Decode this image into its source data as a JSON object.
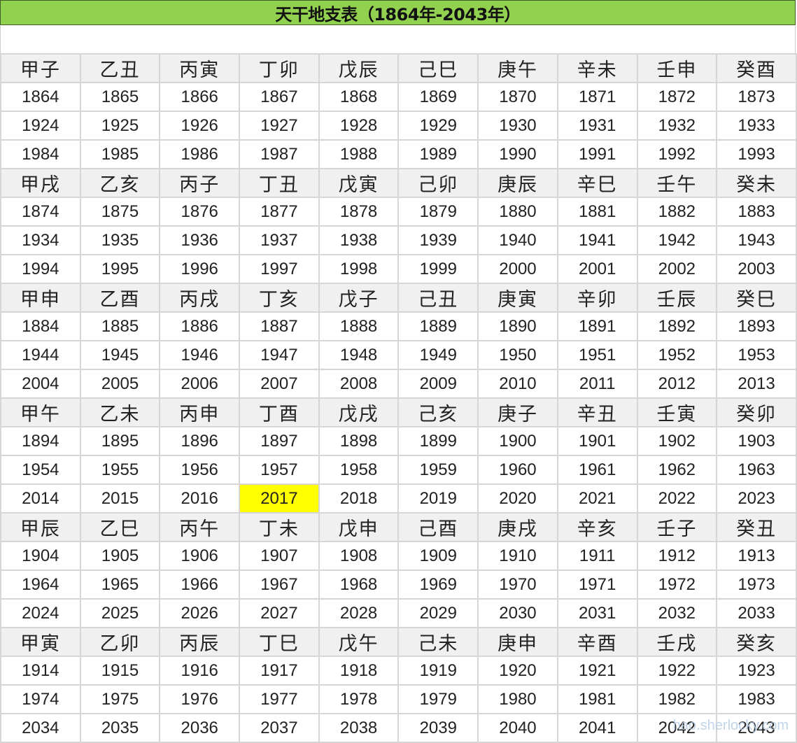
{
  "title": "天干地支表（1864年-2043年）",
  "watermark": "hao.sherlocky.com",
  "highlight_year": "2017",
  "colors": {
    "title_bg": "#92d050",
    "highlight": "#ffff00",
    "header_bg": "#f0f0f0",
    "grid": "#d6d6d6"
  },
  "blocks": [
    {
      "stems": [
        "甲子",
        "乙丑",
        "丙寅",
        "丁卯",
        "戊辰",
        "己巳",
        "庚午",
        "辛未",
        "壬申",
        "癸酉"
      ],
      "years": [
        [
          "1864",
          "1865",
          "1866",
          "1867",
          "1868",
          "1869",
          "1870",
          "1871",
          "1872",
          "1873"
        ],
        [
          "1924",
          "1925",
          "1926",
          "1927",
          "1928",
          "1929",
          "1930",
          "1931",
          "1932",
          "1933"
        ],
        [
          "1984",
          "1985",
          "1986",
          "1987",
          "1988",
          "1989",
          "1990",
          "1991",
          "1992",
          "1993"
        ]
      ]
    },
    {
      "stems": [
        "甲戌",
        "乙亥",
        "丙子",
        "丁丑",
        "戊寅",
        "己卯",
        "庚辰",
        "辛巳",
        "壬午",
        "癸未"
      ],
      "years": [
        [
          "1874",
          "1875",
          "1876",
          "1877",
          "1878",
          "1879",
          "1880",
          "1881",
          "1882",
          "1883"
        ],
        [
          "1934",
          "1935",
          "1936",
          "1937",
          "1938",
          "1939",
          "1940",
          "1941",
          "1942",
          "1943"
        ],
        [
          "1994",
          "1995",
          "1996",
          "1997",
          "1998",
          "1999",
          "2000",
          "2001",
          "2002",
          "2003"
        ]
      ]
    },
    {
      "stems": [
        "甲申",
        "乙酉",
        "丙戌",
        "丁亥",
        "戊子",
        "己丑",
        "庚寅",
        "辛卯",
        "壬辰",
        "癸巳"
      ],
      "years": [
        [
          "1884",
          "1885",
          "1886",
          "1887",
          "1888",
          "1889",
          "1890",
          "1891",
          "1892",
          "1893"
        ],
        [
          "1944",
          "1945",
          "1946",
          "1947",
          "1948",
          "1949",
          "1950",
          "1951",
          "1952",
          "1953"
        ],
        [
          "2004",
          "2005",
          "2006",
          "2007",
          "2008",
          "2009",
          "2010",
          "2011",
          "2012",
          "2013"
        ]
      ]
    },
    {
      "stems": [
        "甲午",
        "乙未",
        "丙申",
        "丁酉",
        "戊戌",
        "己亥",
        "庚子",
        "辛丑",
        "壬寅",
        "癸卯"
      ],
      "years": [
        [
          "1894",
          "1895",
          "1896",
          "1897",
          "1898",
          "1899",
          "1900",
          "1901",
          "1902",
          "1903"
        ],
        [
          "1954",
          "1955",
          "1956",
          "1957",
          "1958",
          "1959",
          "1960",
          "1961",
          "1962",
          "1963"
        ],
        [
          "2014",
          "2015",
          "2016",
          "2017",
          "2018",
          "2019",
          "2020",
          "2021",
          "2022",
          "2023"
        ]
      ]
    },
    {
      "stems": [
        "甲辰",
        "乙巳",
        "丙午",
        "丁未",
        "戊申",
        "己酉",
        "庚戌",
        "辛亥",
        "壬子",
        "癸丑"
      ],
      "years": [
        [
          "1904",
          "1905",
          "1906",
          "1907",
          "1908",
          "1909",
          "1910",
          "1911",
          "1912",
          "1913"
        ],
        [
          "1964",
          "1965",
          "1966",
          "1967",
          "1968",
          "1969",
          "1970",
          "1971",
          "1972",
          "1973"
        ],
        [
          "2024",
          "2025",
          "2026",
          "2027",
          "2028",
          "2029",
          "2030",
          "2031",
          "2032",
          "2033"
        ]
      ]
    },
    {
      "stems": [
        "甲寅",
        "乙卯",
        "丙辰",
        "丁巳",
        "戊午",
        "己未",
        "庚申",
        "辛酉",
        "壬戌",
        "癸亥"
      ],
      "years": [
        [
          "1914",
          "1915",
          "1916",
          "1917",
          "1918",
          "1919",
          "1920",
          "1921",
          "1922",
          "1923"
        ],
        [
          "1974",
          "1975",
          "1976",
          "1977",
          "1978",
          "1979",
          "1980",
          "1981",
          "1982",
          "1983"
        ],
        [
          "2034",
          "2035",
          "2036",
          "2037",
          "2038",
          "2039",
          "2040",
          "2041",
          "2042",
          "2043"
        ]
      ]
    }
  ]
}
